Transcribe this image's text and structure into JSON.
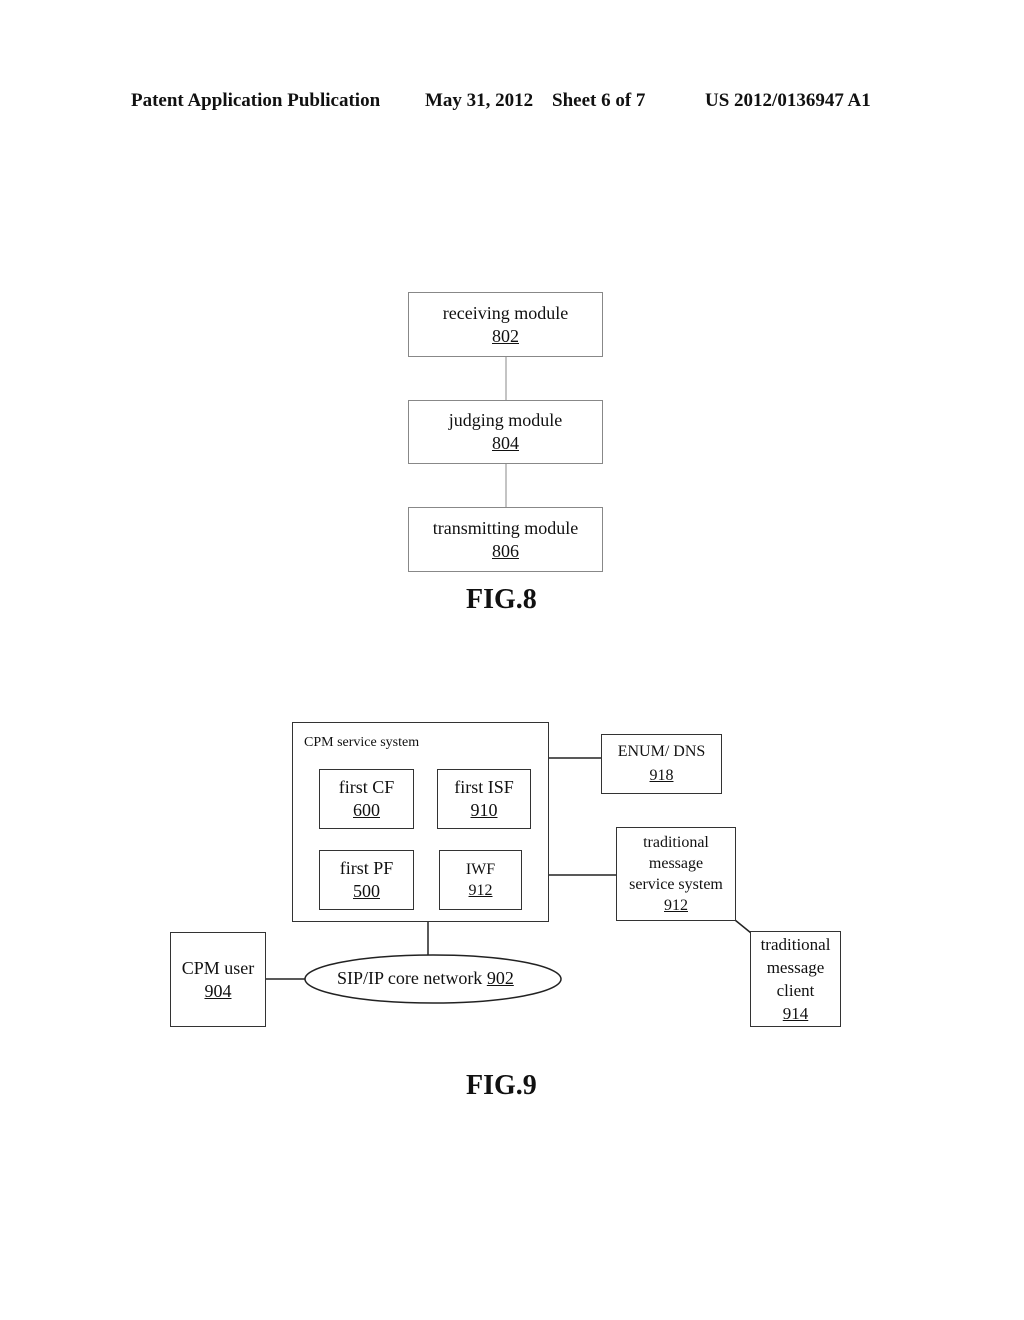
{
  "header": {
    "left": "Patent Application Publication",
    "date": "May 31, 2012",
    "sheet": "Sheet 6 of 7",
    "number": "US 2012/0136947 A1"
  },
  "fig8": {
    "caption": "FIG.8",
    "modules": [
      {
        "label": "receiving module",
        "ref": "802"
      },
      {
        "label": "judging module",
        "ref": "804"
      },
      {
        "label": "transmitting module",
        "ref": "806"
      }
    ]
  },
  "fig9": {
    "caption": "FIG.9",
    "cpm_service_system": {
      "label": "CPM service system",
      "components": [
        {
          "label": "first CF",
          "ref": "600"
        },
        {
          "label": "first ISF",
          "ref": "910"
        },
        {
          "label": "first PF",
          "ref": "500"
        },
        {
          "label": "IWF",
          "ref": "912"
        }
      ]
    },
    "enum_dns": {
      "label": "ENUM/ DNS",
      "ref": "918"
    },
    "traditional_message_service_system": {
      "label_lines": [
        "traditional",
        "message",
        "service system"
      ],
      "ref": "912"
    },
    "traditional_message_client": {
      "label_lines": [
        "traditional",
        "message",
        "client"
      ],
      "ref": "914"
    },
    "cpm_user": {
      "label": "CPM user",
      "ref": "904"
    },
    "core_network": {
      "label": "SIP/IP core network",
      "ref": "902"
    }
  }
}
